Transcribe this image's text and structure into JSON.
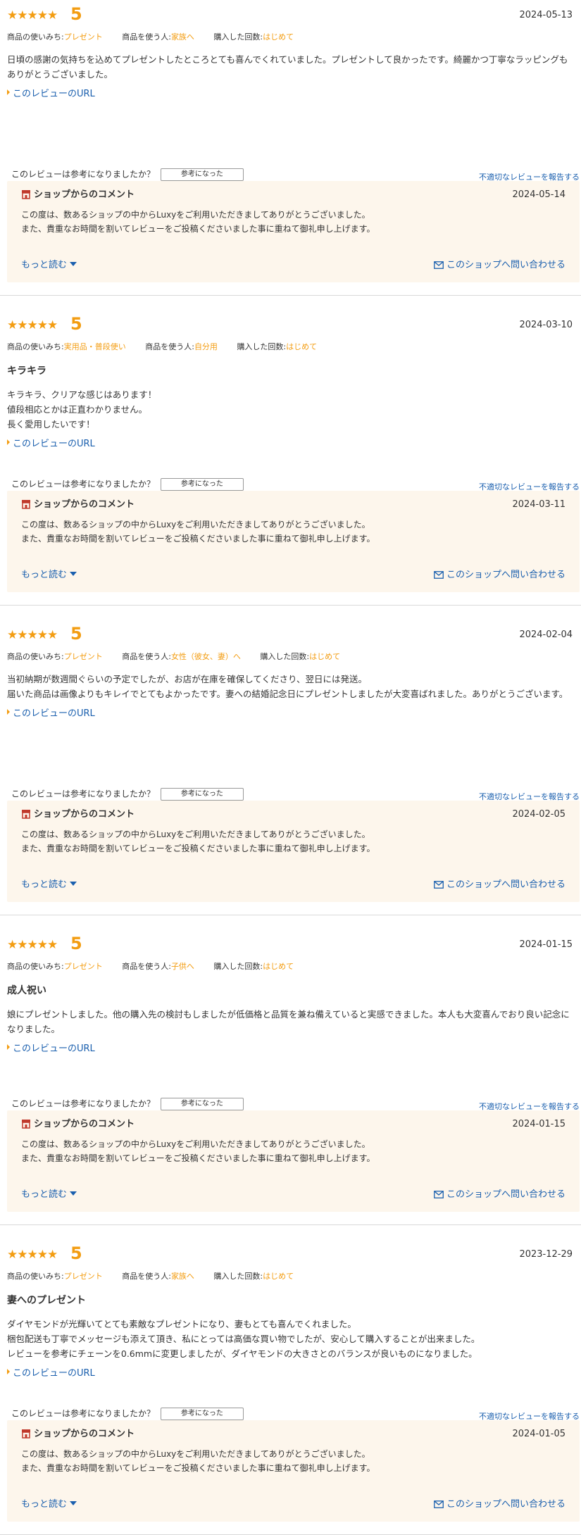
{
  "common": {
    "stars": "★★★★★",
    "url_link": "このレビューのURL",
    "helpful_question": "このレビューは参考になりましたか？",
    "helpful_button": "参考になった",
    "report_link": "不適切なレビューを報告する",
    "shop_comment_title": "ショップからのコメント",
    "shop_comment_body": "この度は、数あるショップの中からLuxyをご利用いただきましてありがとうございました。\nまた、貴重なお時間を割いてレビューをご投稿くださいました事に重ねて御礼申し上げます。",
    "read_more": "もっと読む",
    "contact_shop": "このショップへ問い合わせる",
    "meta_labels": {
      "usage": "商品の使いみち:",
      "user": "商品を使う人:",
      "count": "購入した回数:"
    }
  },
  "reviews": [
    {
      "score": "5",
      "date": "2024-05-13",
      "usage": "プレゼント",
      "user": "家族へ",
      "count": "はじめて",
      "title": "",
      "body": "日頃の感謝の気持ちを込めてプレゼントしたところとても喜んでくれていました。プレゼントして良かったです。綺麗かつ丁寧なラッピングもありがとうございました。",
      "shop_date": "2024-05-14"
    },
    {
      "score": "5",
      "date": "2024-03-10",
      "usage": "実用品・普段使い",
      "user": "自分用",
      "count": "はじめて",
      "title": "キラキラ",
      "body": "キラキラ、クリアな感じはあります！\n値段相応とかは正直わかりません。\n長く愛用したいです！",
      "shop_date": "2024-03-11"
    },
    {
      "score": "5",
      "date": "2024-02-04",
      "usage": "プレゼント",
      "user": "女性（彼女、妻）へ",
      "count": "はじめて",
      "title": "",
      "body": "当初納期が数週間ぐらいの予定でしたが、お店が在庫を確保してくださり、翌日には発送。\n届いた商品は画像よりもキレイでとてもよかったです。妻への結婚記念日にプレゼントしましたが大変喜ばれました。ありがとうございます。",
      "shop_date": "2024-02-05"
    },
    {
      "score": "5",
      "date": "2024-01-15",
      "usage": "プレゼント",
      "user": "子供へ",
      "count": "はじめて",
      "title": "成人祝い",
      "body": "娘にプレゼントしました。他の購入先の検討もしましたが低価格と品質を兼ね備えていると実感できました。本人も大変喜んでおり良い記念になりました。",
      "shop_date": "2024-01-15"
    },
    {
      "score": "5",
      "date": "2023-12-29",
      "usage": "プレゼント",
      "user": "家族へ",
      "count": "はじめて",
      "title": "妻へのプレゼント",
      "body": "ダイヤモンドが光輝いてとても素敵なプレゼントになり、妻もとても喜んでくれました。\n梱包配送も丁寧でメッセージも添えて頂き、私にとっては高価な買い物でしたが、安心して購入することが出来ました。\nレビューを参考にチェーンを0.6mmに変更しましたが、ダイヤモンドの大きさとのバランスが良いものになりました。",
      "shop_date": "2024-01-05"
    }
  ]
}
